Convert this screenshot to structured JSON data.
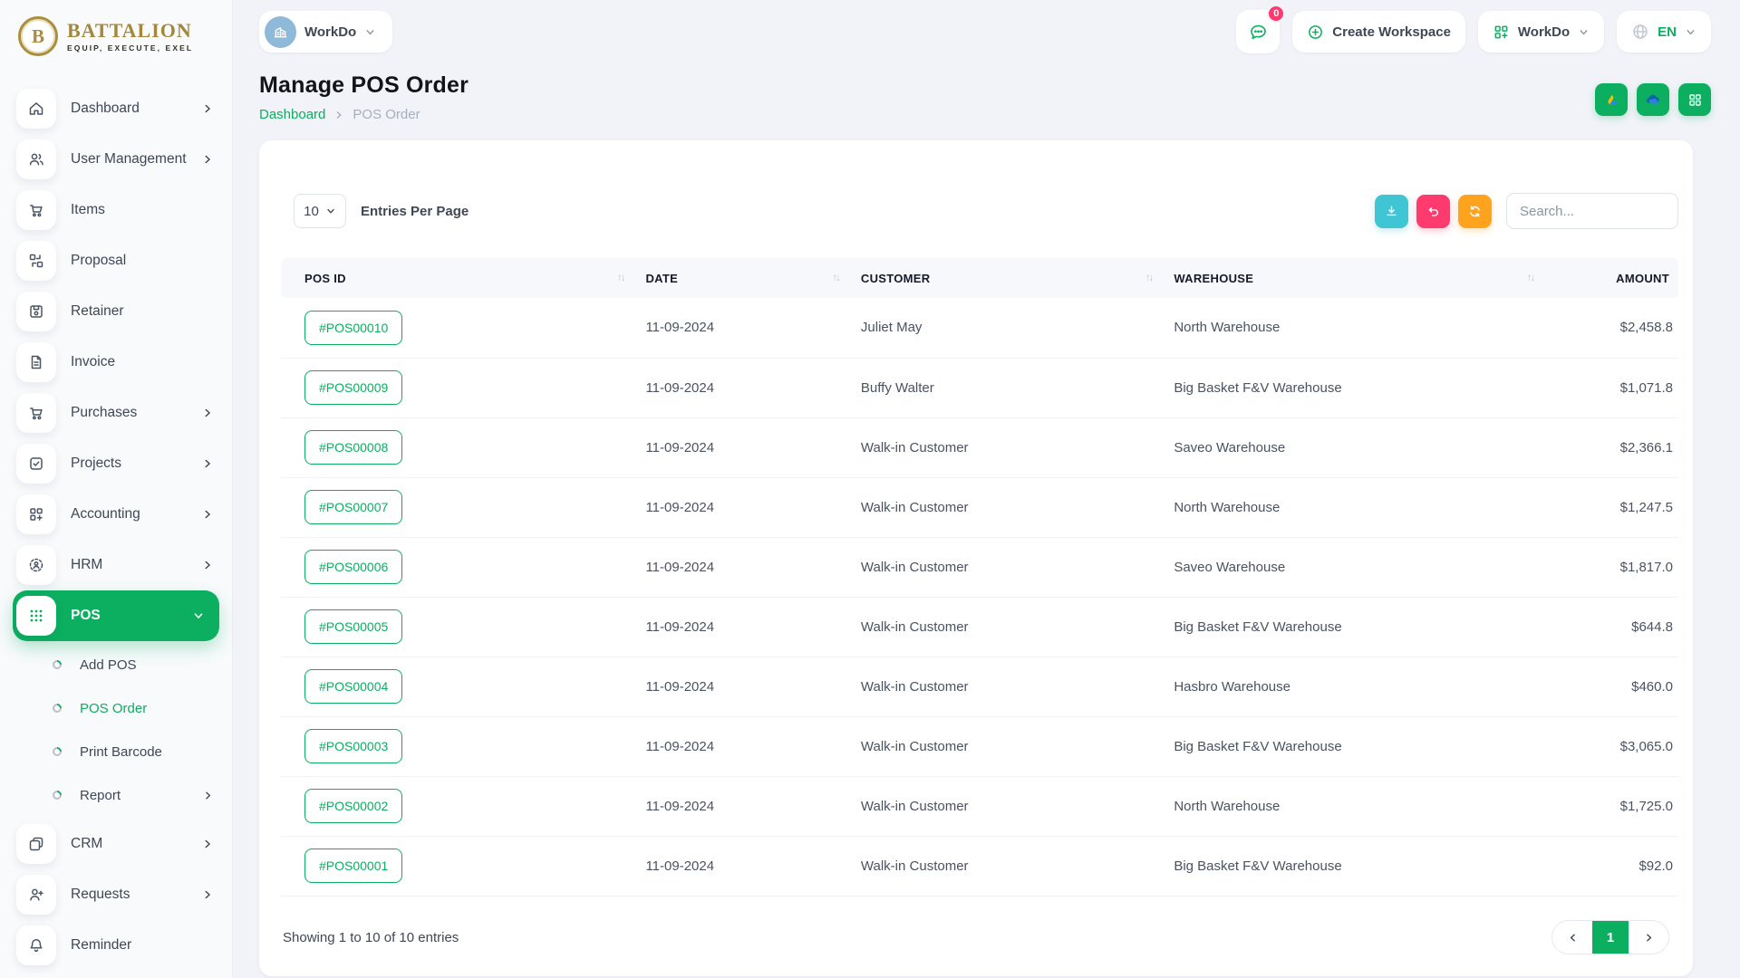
{
  "brand": {
    "name": "BATTALION",
    "tagline": "EQUIP, EXECUTE, EXEL",
    "monogram": "B"
  },
  "header": {
    "workspace_name": "WorkDo",
    "messages_badge": "0",
    "create_workspace_label": "Create Workspace",
    "app_switcher_label": "WorkDo",
    "language": "EN"
  },
  "sidebar": {
    "items": [
      {
        "label": "Dashboard",
        "icon": "home-icon",
        "has_children": true
      },
      {
        "label": "User Management",
        "icon": "users-icon",
        "has_children": true
      },
      {
        "label": "Items",
        "icon": "cart-icon",
        "has_children": false
      },
      {
        "label": "Proposal",
        "icon": "grid-swap-icon",
        "has_children": false
      },
      {
        "label": "Retainer",
        "icon": "floppy-icon",
        "has_children": false
      },
      {
        "label": "Invoice",
        "icon": "document-icon",
        "has_children": false
      },
      {
        "label": "Purchases",
        "icon": "cart-icon",
        "has_children": true
      },
      {
        "label": "Projects",
        "icon": "check-square-icon",
        "has_children": true
      },
      {
        "label": "Accounting",
        "icon": "grid-plus-icon",
        "has_children": true
      },
      {
        "label": "HRM",
        "icon": "person-circle-icon",
        "has_children": true
      },
      {
        "label": "POS",
        "icon": "dots-grid-icon",
        "has_children": true,
        "active": true
      },
      {
        "label": "CRM",
        "icon": "cards-icon",
        "has_children": true
      },
      {
        "label": "Requests",
        "icon": "user-plus-icon",
        "has_children": true
      },
      {
        "label": "Reminder",
        "icon": "bell-icon",
        "has_children": false
      }
    ],
    "pos_children": [
      {
        "label": "Add POS",
        "active": false
      },
      {
        "label": "POS Order",
        "active": true
      },
      {
        "label": "Print Barcode",
        "active": false
      },
      {
        "label": "Report",
        "active": false,
        "has_children": true
      }
    ]
  },
  "page": {
    "title": "Manage POS Order",
    "breadcrumb": [
      "Dashboard",
      "POS Order"
    ],
    "quick_actions": [
      "google-drive-icon",
      "onedrive-icon",
      "grid-icon"
    ]
  },
  "toolbar": {
    "entries_value": "10",
    "entries_label": "Entries Per Page",
    "actions": [
      "download-icon",
      "undo-icon",
      "refresh-icon"
    ],
    "search_placeholder": "Search..."
  },
  "table": {
    "columns": [
      "POS ID",
      "DATE",
      "CUSTOMER",
      "WAREHOUSE",
      "AMOUNT"
    ],
    "rows": [
      {
        "id": "#POS00010",
        "date": "11-09-2024",
        "customer": "Juliet May",
        "warehouse": "North Warehouse",
        "amount": "$2,458.8"
      },
      {
        "id": "#POS00009",
        "date": "11-09-2024",
        "customer": "Buffy Walter",
        "warehouse": "Big Basket F&V Warehouse",
        "amount": "$1,071.8"
      },
      {
        "id": "#POS00008",
        "date": "11-09-2024",
        "customer": "Walk-in Customer",
        "warehouse": "Saveo Warehouse",
        "amount": "$2,366.1"
      },
      {
        "id": "#POS00007",
        "date": "11-09-2024",
        "customer": "Walk-in Customer",
        "warehouse": "North Warehouse",
        "amount": "$1,247.5"
      },
      {
        "id": "#POS00006",
        "date": "11-09-2024",
        "customer": "Walk-in Customer",
        "warehouse": "Saveo Warehouse",
        "amount": "$1,817.0"
      },
      {
        "id": "#POS00005",
        "date": "11-09-2024",
        "customer": "Walk-in Customer",
        "warehouse": "Big Basket F&V Warehouse",
        "amount": "$644.8"
      },
      {
        "id": "#POS00004",
        "date": "11-09-2024",
        "customer": "Walk-in Customer",
        "warehouse": "Hasbro Warehouse",
        "amount": "$460.0"
      },
      {
        "id": "#POS00003",
        "date": "11-09-2024",
        "customer": "Walk-in Customer",
        "warehouse": "Big Basket F&V Warehouse",
        "amount": "$3,065.0"
      },
      {
        "id": "#POS00002",
        "date": "11-09-2024",
        "customer": "Walk-in Customer",
        "warehouse": "North Warehouse",
        "amount": "$1,725.0"
      },
      {
        "id": "#POS00001",
        "date": "11-09-2024",
        "customer": "Walk-in Customer",
        "warehouse": "Big Basket F&V Warehouse",
        "amount": "$92.0"
      }
    ]
  },
  "footer": {
    "showing_text": "Showing 1 to 10 of 10 entries",
    "page": "1"
  },
  "colors": {
    "primary_green": "#0caf60",
    "cyan": "#3fc5d4",
    "pink": "#ff3a6e",
    "orange": "#ffa21d",
    "brand_gold": "#a3873b",
    "badge_red": "#ff3a6e"
  }
}
